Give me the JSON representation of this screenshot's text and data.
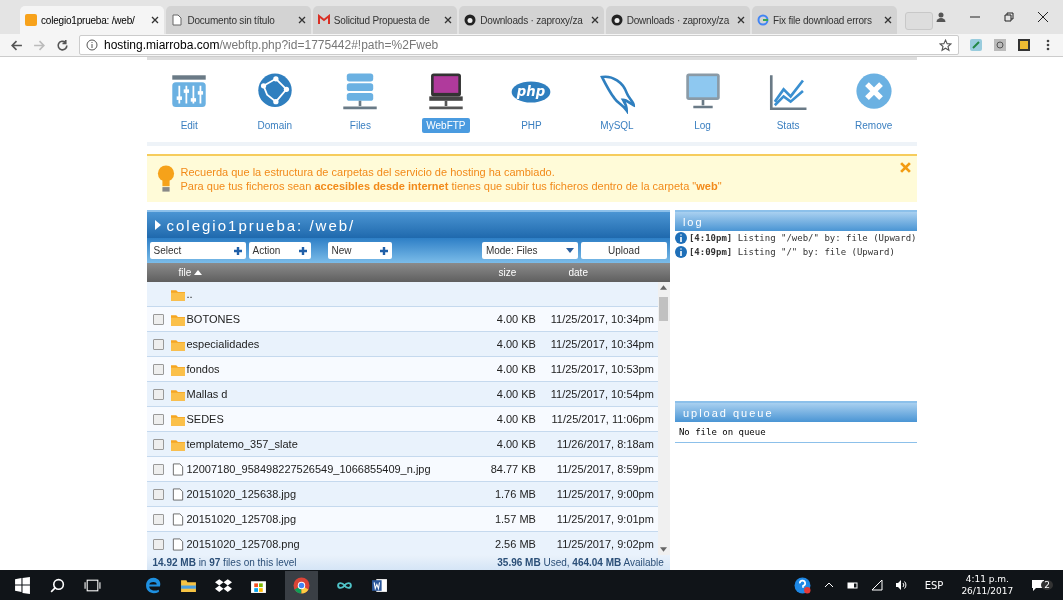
{
  "browser": {
    "tabs": [
      {
        "title": "colegio1prueba: /web/",
        "selected": true
      },
      {
        "title": "Documento sin título",
        "selected": false
      },
      {
        "title": "Solicitud Propuesta de",
        "selected": false
      },
      {
        "title": "Downloads · zaproxy/za",
        "selected": false
      },
      {
        "title": "Downloads · zaproxy/za",
        "selected": false
      },
      {
        "title": "Fix file download errors",
        "selected": false
      }
    ],
    "url_host": "hosting.miarroba.com",
    "url_path": "/webftp.php?id=1775442#!path=%2Fweb"
  },
  "nav": [
    {
      "label": "Edit",
      "selected": false
    },
    {
      "label": "Domain",
      "selected": false
    },
    {
      "label": "Files",
      "selected": false
    },
    {
      "label": "WebFTP",
      "selected": true
    },
    {
      "label": "PHP",
      "logo_text": "php",
      "selected": false
    },
    {
      "label": "MySQL",
      "selected": false
    },
    {
      "label": "Log",
      "selected": false
    },
    {
      "label": "Stats",
      "selected": false
    },
    {
      "label": "Remove",
      "selected": false
    }
  ],
  "notice": {
    "lines": [
      "Recuerda que la estructura de carpetas del servicio de hosting ha cambiado.",
      "Para que tus ficheros sean **accesibles desde internet** tienes que subir tus ficheros dentro de la carpeta \"**web**\""
    ]
  },
  "browser_panel": {
    "title": "colegio1prueba: /web/",
    "toolbar": {
      "select": "Select",
      "action": "Action",
      "new": "New",
      "mode": "Mode: Files",
      "upload": "Upload"
    },
    "columns": {
      "file": "file",
      "size": "size",
      "date": "date"
    },
    "rows": [
      {
        "kind": "parent",
        "name": ".."
      },
      {
        "kind": "folder",
        "name": "BOTONES",
        "size": "4.00 KB",
        "date": "11/25/2017, 10:34pm",
        "checked": false
      },
      {
        "kind": "folder",
        "name": "especialidades",
        "size": "4.00 KB",
        "date": "11/25/2017, 10:34pm",
        "checked": false
      },
      {
        "kind": "folder",
        "name": "fondos",
        "size": "4.00 KB",
        "date": "11/25/2017, 10:53pm",
        "checked": false
      },
      {
        "kind": "folder",
        "name": "Mallas d",
        "size": "4.00 KB",
        "date": "11/25/2017, 10:54pm",
        "checked": false
      },
      {
        "kind": "folder",
        "name": "SEDES",
        "size": "4.00 KB",
        "date": "11/25/2017, 11:06pm",
        "checked": false
      },
      {
        "kind": "folder",
        "name": "templatemo_357_slate",
        "size": "4.00 KB",
        "date": "11/26/2017, 8:18am",
        "checked": false
      },
      {
        "kind": "file",
        "name": "12007180_958498227526549_1066855409_n.jpg",
        "size": "84.77 KB",
        "date": "11/25/2017, 8:59pm",
        "checked": false
      },
      {
        "kind": "file",
        "name": "20151020_125638.jpg",
        "size": "1.76 MB",
        "date": "11/25/2017, 9:00pm",
        "checked": false
      },
      {
        "kind": "file",
        "name": "20151020_125708.jpg",
        "size": "1.57 MB",
        "date": "11/25/2017, 9:01pm",
        "checked": false
      },
      {
        "kind": "file",
        "name": "20151020_125708.png",
        "size": "2.56 MB",
        "date": "11/25/2017, 9:02pm",
        "checked": false
      }
    ],
    "footer_left": "**14.92 MB** in **97** files on this level",
    "footer_right": "**35.96 MB** Used, **464.04 MB** Available"
  },
  "log": {
    "title": "log",
    "entries": [
      {
        "time": "[4:10pm]",
        "text": "Listing \"/web/\" by: file (Upward)"
      },
      {
        "time": "[4:09pm]",
        "text": "Listing \"/\" by: file (Upward)"
      }
    ]
  },
  "upload_queue": {
    "title": "upload queue",
    "text": "No file on queue"
  },
  "taskbar": {
    "language": "ESP",
    "time": "4:11 p.m.",
    "date": "26/11/2017",
    "notifications": "2"
  }
}
